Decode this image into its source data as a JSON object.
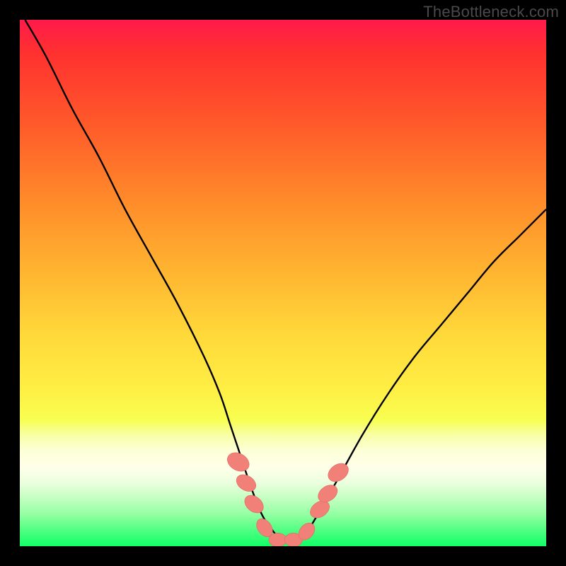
{
  "watermark": "TheBottleneck.com",
  "chart_data": {
    "type": "line",
    "title": "",
    "xlabel": "",
    "ylabel": "",
    "xlim": [
      0,
      100
    ],
    "ylim": [
      0,
      100
    ],
    "series": [
      {
        "name": "bottleneck-curve",
        "x": [
          1,
          5,
          10,
          15,
          20,
          25,
          30,
          35,
          38,
          40,
          42,
          44,
          46,
          48,
          50,
          52,
          54,
          56,
          60,
          65,
          70,
          75,
          80,
          85,
          90,
          95,
          100
        ],
        "y": [
          100,
          93,
          83,
          74,
          64,
          55,
          46,
          36,
          29,
          23,
          17,
          11,
          6,
          3,
          1,
          1,
          2,
          5,
          12,
          21,
          29,
          36,
          42,
          48,
          54,
          59,
          64
        ]
      }
    ],
    "markers": [
      {
        "x": 41.5,
        "y": 16,
        "rx": 1.6,
        "ry": 2.2,
        "angle": -60
      },
      {
        "x": 43.0,
        "y": 12,
        "rx": 1.4,
        "ry": 2.0,
        "angle": -58
      },
      {
        "x": 44.5,
        "y": 8,
        "rx": 1.4,
        "ry": 2.0,
        "angle": -50
      },
      {
        "x": 46.5,
        "y": 3.5,
        "rx": 1.3,
        "ry": 1.9,
        "angle": -35
      },
      {
        "x": 49.0,
        "y": 1.2,
        "rx": 1.7,
        "ry": 1.3,
        "angle": 0
      },
      {
        "x": 52.0,
        "y": 1.2,
        "rx": 1.7,
        "ry": 1.3,
        "angle": 0
      },
      {
        "x": 54.5,
        "y": 2.8,
        "rx": 1.3,
        "ry": 1.8,
        "angle": 40
      },
      {
        "x": 57.0,
        "y": 7,
        "rx": 1.4,
        "ry": 2.0,
        "angle": 55
      },
      {
        "x": 58.5,
        "y": 10,
        "rx": 1.4,
        "ry": 2.0,
        "angle": 55
      },
      {
        "x": 60.5,
        "y": 14,
        "rx": 1.5,
        "ry": 2.1,
        "angle": 55
      }
    ],
    "colors": {
      "curve": "#000000",
      "marker_fill": "#f08078",
      "marker_stroke": "#e06a62"
    }
  }
}
